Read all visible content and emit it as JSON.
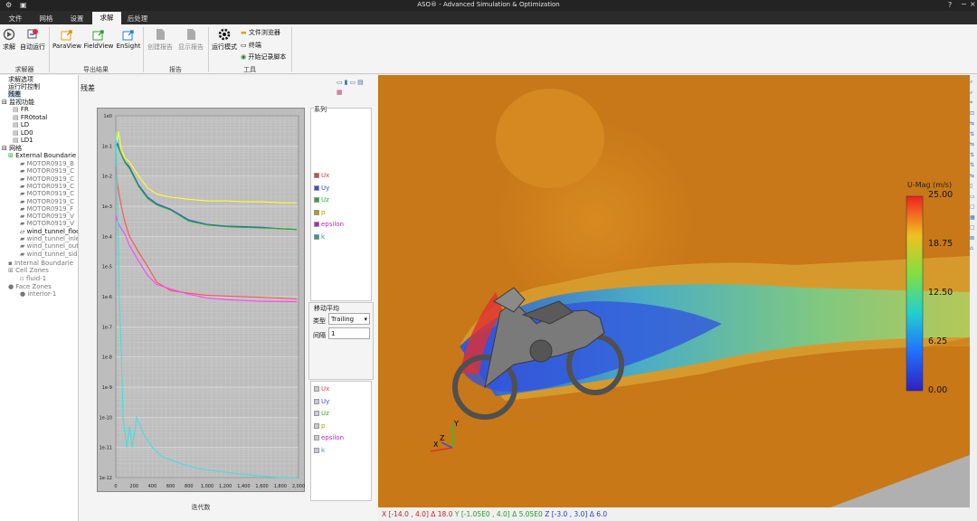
{
  "window": {
    "title": "ASO® - Advanced Simulation & Optimization",
    "quick_icons": [
      "gear-icon",
      "save-icon"
    ]
  },
  "menu": {
    "tabs": [
      "文件",
      "网格",
      "设置",
      "求解",
      "后处理"
    ],
    "active": "求解"
  },
  "ribbon": {
    "solver": {
      "buttons": [
        "求解",
        "自动运行"
      ],
      "group": "求解器"
    },
    "export": {
      "buttons": [
        "ParaView",
        "FieldView",
        "EnSight"
      ],
      "group": "导出结果"
    },
    "report": {
      "buttons": [
        "创建报告",
        "显示报告"
      ],
      "group": "报告"
    },
    "tools": {
      "run_mode": "运行模式",
      "file_browser": "文件浏览器",
      "terminal": "终端",
      "record_script": "开始记录脚本",
      "group": "工具"
    }
  },
  "tree": {
    "solve_options": "求解选项",
    "runtime_control": "运行时控制",
    "residuals": "残差",
    "monitors": "监视功能",
    "monitor_items": [
      "FR",
      "FR0total",
      "LD",
      "LD0",
      "LD1"
    ],
    "mesh": "网格",
    "external_boundaries": "External Boundarie",
    "boundaries": [
      "MOTOR0919_B",
      "MOTOR0919_C",
      "MOTOR0919_C",
      "MOTOR0919_C",
      "MOTOR0919_C",
      "MOTOR0919_C",
      "MOTOR0919_F",
      "MOTOR0919_V",
      "MOTOR0919_V",
      "wind_tunnel_floo",
      "wind_tunnel_inle",
      "wind_tunnel_out",
      "wind_tunnel_sid"
    ],
    "internal_boundaries": "Internal Boundarie",
    "cell_zones": "Cell Zones",
    "fluid": "fluid-1",
    "face_zones": "Face Zones",
    "interior": "interior-1"
  },
  "residual_panel": {
    "title": "残差",
    "series_label": "系列",
    "moving_avg_label": "移动平均",
    "type_label": "类型",
    "type_value": "Trailing",
    "interval_label": "间隔",
    "interval_value": "1",
    "legend": [
      {
        "name": "Ux",
        "color": "#e04040"
      },
      {
        "name": "Uy",
        "color": "#3050e0"
      },
      {
        "name": "Uz",
        "color": "#20b020"
      },
      {
        "name": "p",
        "color": "#b0a000"
      },
      {
        "name": "epsilon",
        "color": "#c020c0"
      },
      {
        "name": "k",
        "color": "#20a0a0"
      }
    ]
  },
  "chart_data": {
    "type": "line",
    "xlabel": "迭代数",
    "ylabel": "",
    "yscale": "log",
    "xlim": [
      0,
      2000
    ],
    "ylim": [
      1e-12,
      1
    ],
    "x_ticks": [
      "0",
      "200",
      "400",
      "600",
      "800",
      "1,000",
      "1,200",
      "1,400",
      "1,600",
      "1,800",
      "2,000"
    ],
    "y_ticks": [
      "1e0",
      "1e-1",
      "1e-2",
      "1e-3",
      "1e-4",
      "1e-5",
      "1e-6",
      "1e-7",
      "1e-8",
      "1e-9",
      "1e-10",
      "1e-11",
      "1e-12"
    ],
    "grid": true,
    "series": [
      {
        "name": "Ux",
        "color": "#ff5050",
        "points": [
          [
            0,
            0.02
          ],
          [
            20,
            0.005
          ],
          [
            60,
            0.001
          ],
          [
            100,
            0.0003
          ],
          [
            150,
            0.0001
          ],
          [
            250,
            3e-05
          ],
          [
            350,
            1e-05
          ],
          [
            450,
            3e-06
          ],
          [
            600,
            1.6e-06
          ],
          [
            800,
            1.3e-06
          ],
          [
            1000,
            1.1e-06
          ],
          [
            1200,
            1.05e-06
          ],
          [
            1400,
            1e-06
          ],
          [
            1600,
            9.5e-07
          ],
          [
            1800,
            9e-07
          ],
          [
            1980,
            8.5e-07
          ]
        ]
      },
      {
        "name": "Uy",
        "color": "#3050e0",
        "points": [
          [
            0,
            0.1
          ],
          [
            20,
            0.12
          ],
          [
            50,
            0.06
          ],
          [
            100,
            0.03
          ],
          [
            150,
            0.02
          ],
          [
            250,
            0.005
          ],
          [
            350,
            0.002
          ],
          [
            450,
            0.0012
          ],
          [
            600,
            0.0008
          ],
          [
            800,
            0.00035
          ],
          [
            1000,
            0.00025
          ],
          [
            1200,
            0.00022
          ],
          [
            1400,
            0.00021
          ],
          [
            1600,
            0.0002
          ],
          [
            1800,
            0.00018
          ],
          [
            1980,
            0.00017
          ]
        ]
      },
      {
        "name": "Uz",
        "color": "#20b020",
        "points": [
          [
            0,
            0.1
          ],
          [
            20,
            0.1
          ],
          [
            50,
            0.06
          ],
          [
            100,
            0.028
          ],
          [
            150,
            0.018
          ],
          [
            250,
            0.0045
          ],
          [
            350,
            0.0018
          ],
          [
            450,
            0.0011
          ],
          [
            600,
            0.00075
          ],
          [
            800,
            0.00032
          ],
          [
            1000,
            0.00024
          ],
          [
            1200,
            0.00021
          ],
          [
            1400,
            0.0002
          ],
          [
            1600,
            0.00019
          ],
          [
            1800,
            0.00018
          ],
          [
            1980,
            0.00017
          ]
        ]
      },
      {
        "name": "p",
        "color": "#ffff30",
        "points": [
          [
            0,
            0.3
          ],
          [
            15,
            0.15
          ],
          [
            30,
            0.3
          ],
          [
            60,
            0.08
          ],
          [
            100,
            0.04
          ],
          [
            150,
            0.03
          ],
          [
            250,
            0.01
          ],
          [
            350,
            0.004
          ],
          [
            450,
            0.0025
          ],
          [
            600,
            0.002
          ],
          [
            800,
            0.0017
          ],
          [
            1000,
            0.0015
          ],
          [
            1200,
            0.0015
          ],
          [
            1400,
            0.0014
          ],
          [
            1600,
            0.0014
          ],
          [
            1800,
            0.0013
          ],
          [
            1980,
            0.0013
          ]
        ]
      },
      {
        "name": "epsilon",
        "color": "#ff40ff",
        "points": [
          [
            0,
            0.0005
          ],
          [
            20,
            0.0003
          ],
          [
            50,
            0.0002
          ],
          [
            100,
            0.00012
          ],
          [
            150,
            5e-05
          ],
          [
            250,
            1.5e-05
          ],
          [
            350,
            5e-06
          ],
          [
            450,
            2.5e-06
          ],
          [
            600,
            1.8e-06
          ],
          [
            800,
            1.2e-06
          ],
          [
            1000,
            9e-07
          ],
          [
            1200,
            8e-07
          ],
          [
            1400,
            7.5e-07
          ],
          [
            1600,
            7e-07
          ],
          [
            1800,
            7e-07
          ],
          [
            1980,
            6.8e-07
          ]
        ]
      },
      {
        "name": "k",
        "color": "#40e0e0",
        "points": [
          [
            0,
            0.3
          ],
          [
            20,
            0.001
          ],
          [
            40,
            1e-06
          ],
          [
            60,
            1e-08
          ],
          [
            80,
            1e-10
          ],
          [
            100,
            3e-11
          ],
          [
            120,
            1e-11
          ],
          [
            150,
            5e-11
          ],
          [
            180,
            1e-11
          ],
          [
            230,
            1e-10
          ],
          [
            300,
            3e-11
          ],
          [
            400,
            1e-11
          ],
          [
            500,
            5e-12
          ],
          [
            700,
            3e-12
          ],
          [
            900,
            2e-12
          ],
          [
            1200,
            1.5e-12
          ],
          [
            1500,
            1.2e-12
          ],
          [
            1800,
            1e-12
          ],
          [
            1980,
            1e-12
          ]
        ]
      }
    ]
  },
  "colorbar": {
    "title": "U-Mag (m/s)",
    "labels": [
      "25.00",
      "18.75",
      "12.50",
      "6.25",
      "0.00"
    ],
    "min": 0,
    "max": 25
  },
  "axis_triad": {
    "labels": [
      "Y",
      "Z",
      "X"
    ]
  },
  "status": {
    "x_label": "X",
    "x_range": "[-14.0 , 4.0]",
    "x_delta": "Δ 18.0",
    "y_label": "Y",
    "y_range": "[-1.05E0 , 4.0]",
    "y_delta": "Δ 5.05E0",
    "z_label": "Z",
    "z_range": "[-3.0 , 3.0]",
    "z_delta": "Δ 6.0"
  }
}
